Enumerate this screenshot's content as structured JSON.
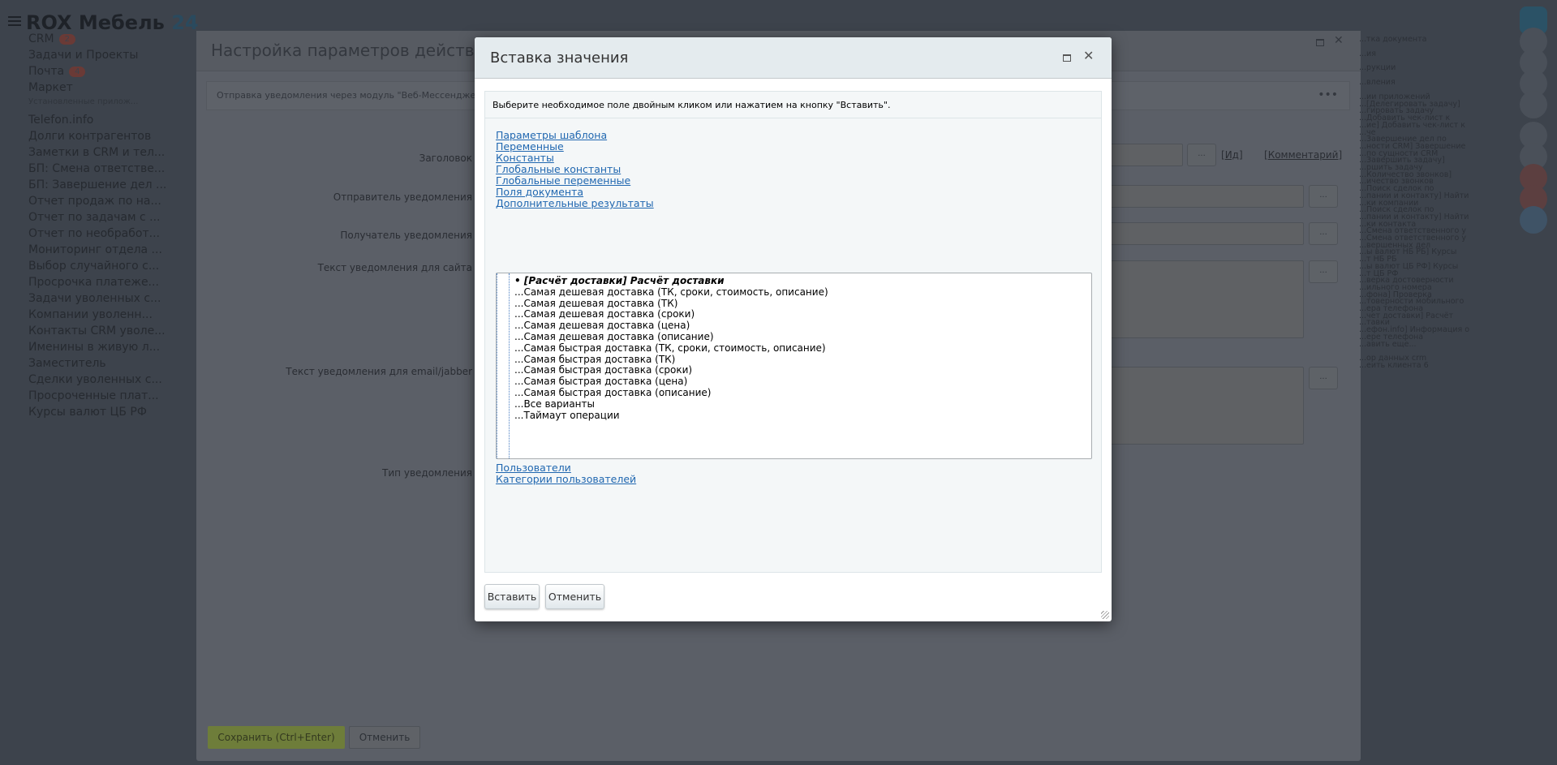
{
  "app": {
    "logo_main": "ROX Мебель",
    "logo_num": "24"
  },
  "sidebar": {
    "items": [
      {
        "label": "CRM",
        "badge": "2"
      },
      {
        "label": "Задачи и Проекты"
      },
      {
        "label": "Почта",
        "badge": "4"
      },
      {
        "label": "Маркет"
      },
      {
        "label": "Установленные прилож..."
      },
      {
        "label": "Telefon.info"
      },
      {
        "label": "Долги контрагентов"
      },
      {
        "label": "Заметки в CRM и тел..."
      },
      {
        "label": "БП: Смена ответстве..."
      },
      {
        "label": "БП: Завершение дел ..."
      },
      {
        "label": "Отчет продаж по на..."
      },
      {
        "label": "Отчет по задачам с ..."
      },
      {
        "label": "Отчет по необработ..."
      },
      {
        "label": "Мониторинг отдела ..."
      },
      {
        "label": "Выбор случайного с..."
      },
      {
        "label": "Просрочка платеже..."
      },
      {
        "label": "Задачи уволенных с..."
      },
      {
        "label": "Компании уволенн..."
      },
      {
        "label": "Контакты CRM уволе..."
      },
      {
        "label": "Именины в живую л..."
      },
      {
        "label": "Заместитель"
      },
      {
        "label": "Сделки уволенных с..."
      },
      {
        "label": "Просроченные плат..."
      },
      {
        "label": "Курсы валют ЦБ РФ"
      }
    ]
  },
  "under": {
    "title": "Настройка параметров действия",
    "subtitle": "Отправка уведомления через модуль \"Веб-Мессенджер\"",
    "labels": [
      "Заголовок",
      "Отправитель уведомления",
      "Получатель уведомления",
      "Текст уведомления для сайта",
      "Текст уведомления для email/jabber",
      "Тип уведомления"
    ],
    "dots_label": "...",
    "id_link": "Ид",
    "comment_link": "Комментарий",
    "save_label": "Сохранить (Ctrl+Enter)",
    "cancel_label": "Отменить"
  },
  "right_panel": {
    "lines": [
      "...тка документа",
      "...ия",
      "...рукции",
      "...вления",
      "...ии приложений",
      "...[Делегировать задачу]",
      "...гировать задачу",
      "...Добавить чек-лист к",
      "...ие] Добавить чек-лист к",
      "...че",
      "...Завершение дел по",
      "...ности CRM] Завершение",
      "...по сущности CRM",
      "...Завершить задачу]",
      "...ршить задачу",
      "...Количество звонков]",
      "...ичество звонков",
      "...Поиск сделок по",
      "...пании и контакту] Найти",
      "...ки компании",
      "...Поиск сделок по",
      "...пании и контакту] Найти",
      "...ки контакта",
      "...Смена ответственного у",
      "...Смена ответственного у",
      "...вершенных дел",
      "...ы валют НБ РБ] Курсы",
      "...т НБ РБ",
      "...ы валют ЦБ РФ] Курсы",
      "...т ЦБ РФ",
      "...верка достоверности",
      "...ильного номера",
      "...фона] Проверка",
      "...товерности мобильного",
      "...ера телефона",
      "...чет доставки] Расчёт",
      "...тавки",
      "...ефон.info] Информация о",
      "...ере телефона",
      "...авить еще...",
      "",
      "...ор данных crm",
      "...еить клиента 6"
    ]
  },
  "dialog": {
    "title": "Вставка значения",
    "hint": "Выберите необходимое поле двойным кликом или нажатием на кнопку \"Вставить\".",
    "groups_top": [
      "Параметры шаблона",
      "Переменные",
      "Константы",
      "Глобальные константы",
      "Глобальные переменные",
      "Поля документа",
      "Дополнительные результаты"
    ],
    "list_options": [
      "• [Расчёт доставки] Расчёт доставки",
      "...Самая дешевая доставка (ТК, сроки, стоимость, описание)",
      "...Самая дешевая доставка (ТК)",
      "...Самая дешевая доставка (сроки)",
      "...Самая дешевая доставка (цена)",
      "...Самая дешевая доставка (описание)",
      "...Самая быстрая доставка (ТК, сроки, стоимость, описание)",
      "...Самая быстрая доставка (ТК)",
      "...Самая быстрая доставка (сроки)",
      "...Самая быстрая доставка (цена)",
      "...Самая быстрая доставка (описание)",
      "...Все варианты",
      "...Таймаут операции"
    ],
    "groups_bottom": [
      "Пользователи",
      "Категории пользователей"
    ],
    "insert_label": "Вставить",
    "cancel_label": "Отменить"
  }
}
